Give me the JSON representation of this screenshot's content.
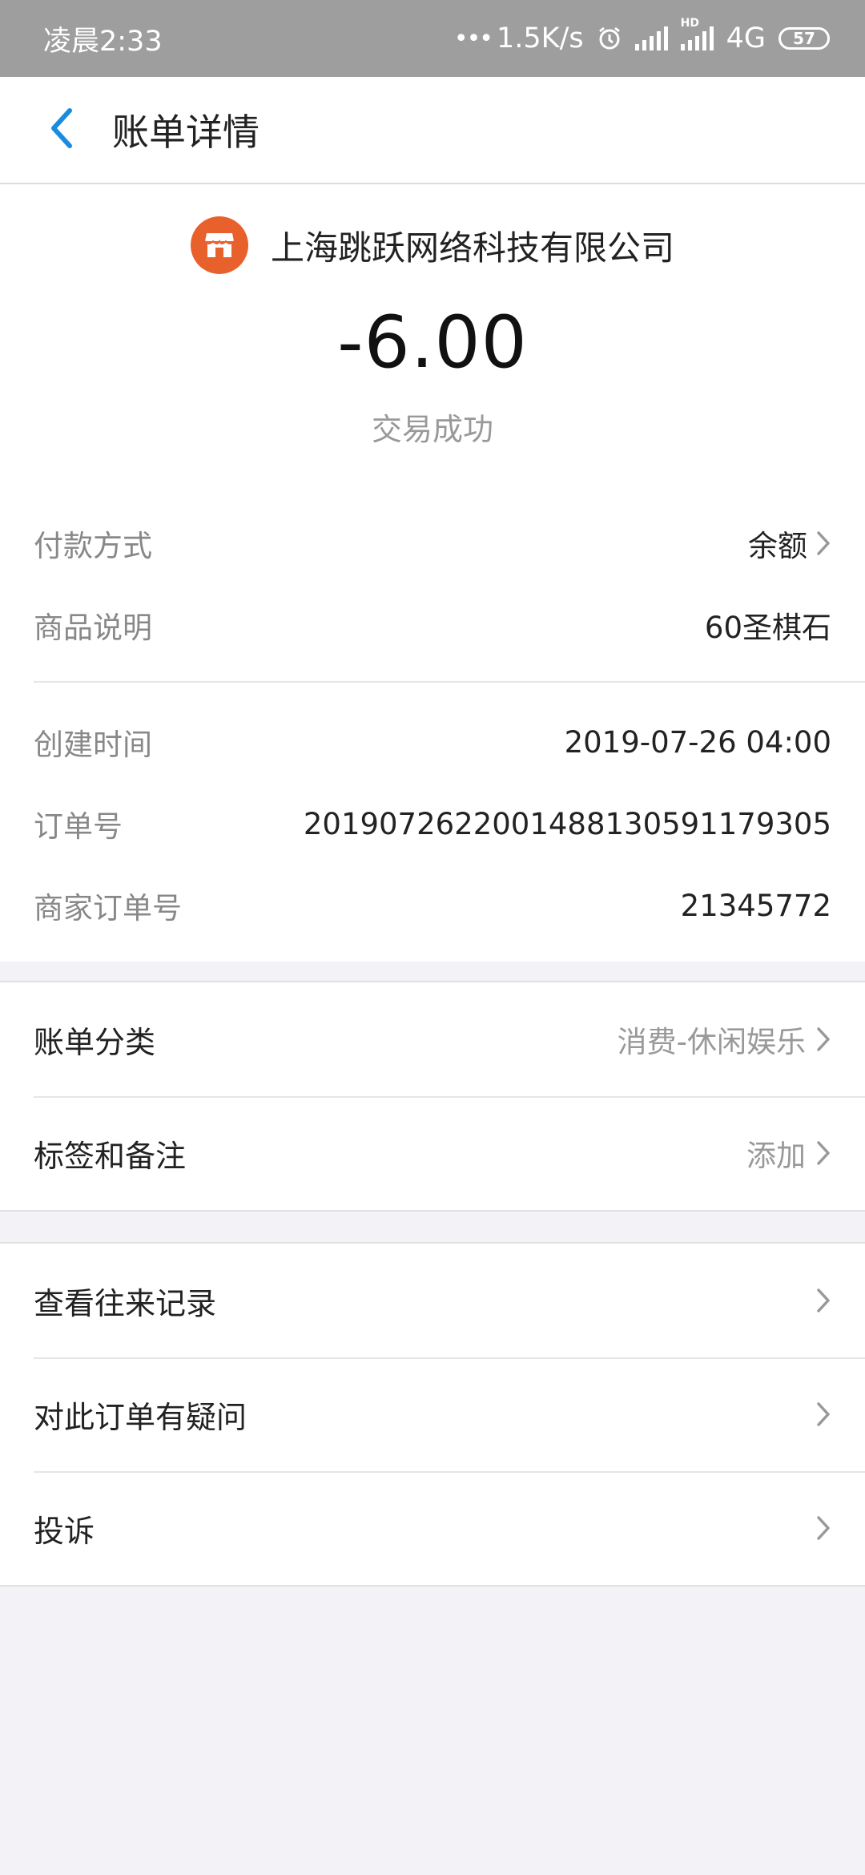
{
  "status_bar": {
    "time": "凌晨2:33",
    "speed": "1.5K/s",
    "hd_label": "HD",
    "network": "4G",
    "battery": "57"
  },
  "header": {
    "title": "账单详情"
  },
  "summary": {
    "merchant": "上海跳跃网络科技有限公司",
    "amount": "-6.00",
    "status": "交易成功"
  },
  "details": [
    {
      "label": "付款方式",
      "value": "余额"
    },
    {
      "label": "商品说明",
      "value": "60圣棋石"
    },
    {
      "label": "创建时间",
      "value": "2019-07-26 04:00"
    },
    {
      "label": "订单号",
      "value": "2019072622001488130591179305"
    },
    {
      "label": "商家订单号",
      "value": "21345772"
    }
  ],
  "category_section": [
    {
      "label": "账单分类",
      "value": "消费-休闲娱乐"
    },
    {
      "label": "标签和备注",
      "value": "添加"
    }
  ],
  "action_section": [
    {
      "label": "查看往来记录"
    },
    {
      "label": "对此订单有疑问"
    },
    {
      "label": "投诉"
    }
  ],
  "colors": {
    "accent": "#1a8ce0",
    "merchant_logo": "#e8612c",
    "status_bar": "#9e9e9e"
  }
}
